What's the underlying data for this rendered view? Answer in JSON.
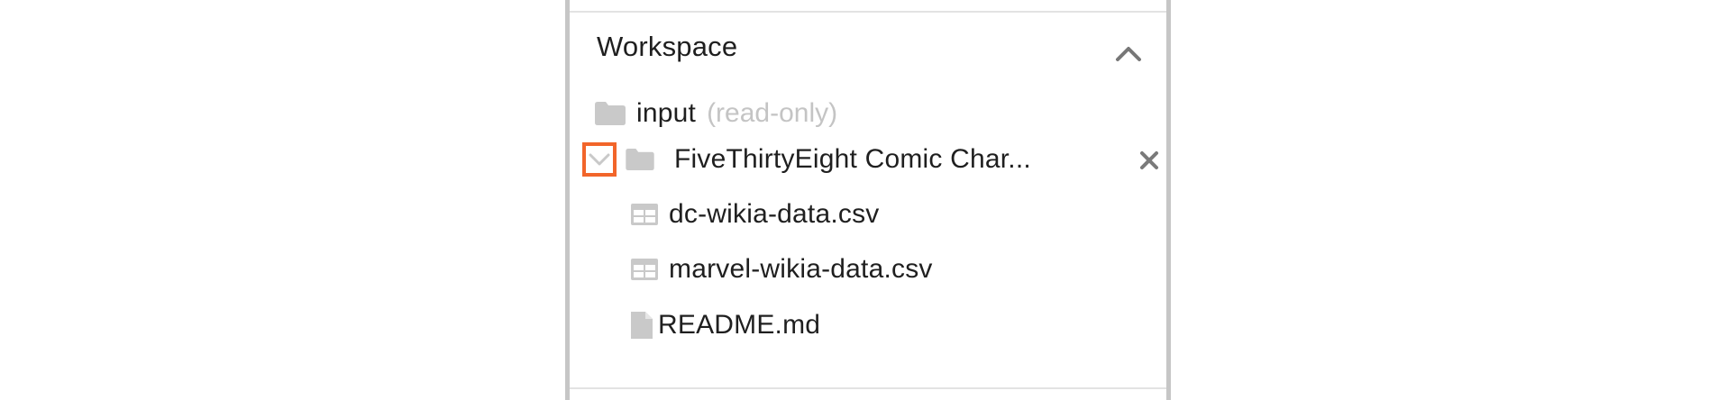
{
  "workspace": {
    "title": "Workspace",
    "collapse_icon": "chevron-up-icon"
  },
  "tree": {
    "input_folder": {
      "label": "input",
      "note": "(read-only)",
      "icon": "folder-icon"
    },
    "dataset": {
      "label": "FiveThirtyEight Comic Char...",
      "icon": "folder-icon",
      "toggle_icon": "chevron-down-icon",
      "remove_icon": "close-icon",
      "files": [
        {
          "label": "dc-wikia-data.csv",
          "icon": "table-icon"
        },
        {
          "label": "marvel-wikia-data.csv",
          "icon": "table-icon"
        },
        {
          "label": "README.md",
          "icon": "file-icon"
        }
      ]
    }
  },
  "colors": {
    "highlight_border": "#f2652a",
    "icon_gray": "#c9c9c9",
    "text": "#1f1f1f",
    "muted_text": "#c4c4c4",
    "panel_border": "#c6c6c6"
  }
}
